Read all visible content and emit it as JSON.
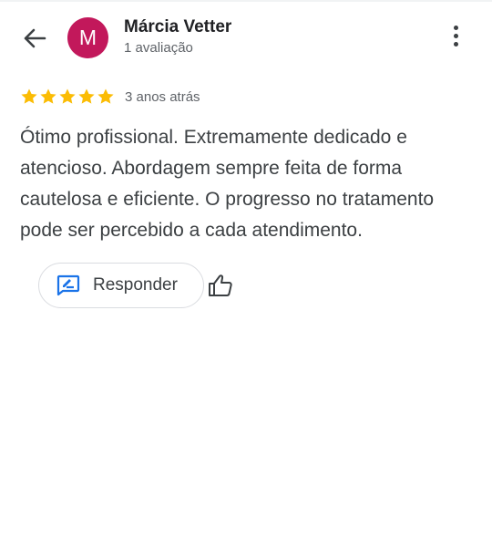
{
  "header": {
    "back_icon": "arrow-back-icon",
    "avatar_letter": "M",
    "avatar_color": "#c2185b",
    "user_name": "Márcia Vetter",
    "review_count": "1 avaliação",
    "more_icon": "more-vertical-icon"
  },
  "review": {
    "rating": 5,
    "max_rating": 5,
    "star_color": "#fbbc04",
    "date": "3 anos atrás",
    "text": "Ótimo profissional. Extremamente dedicado e atencioso. Abordagem sempre feita de forma cautelosa e eficiente. O progresso no tratamento pode ser percebido a cada atendimento."
  },
  "actions": {
    "reply_label": "Responder",
    "reply_icon": "reply-edit-icon",
    "reply_icon_color": "#1a73e8",
    "like_icon": "thumbs-up-icon"
  }
}
